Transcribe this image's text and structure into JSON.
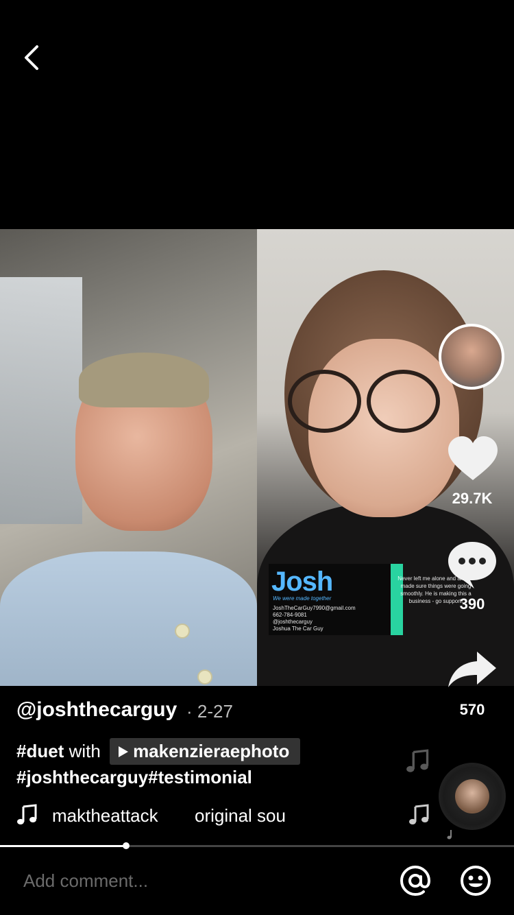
{
  "video": {
    "business_card": {
      "name": "Josh",
      "tagline": "We were made together",
      "email": "JoshTheCarGuy7990@gmail.com",
      "phone": "662-784-9081",
      "tiktok": "@joshthecarguy",
      "youtube": "Joshua The Car Guy"
    },
    "overlay_text": "Never left me alone and always made sure things were going smoothly. He is making this a business - go support!"
  },
  "actions": {
    "likes": "29.7K",
    "comments": "390",
    "shares": "570"
  },
  "post": {
    "username": "@joshthecarguy",
    "date": "· 2-27",
    "duet_prefix": "#duet",
    "duet_with": "with",
    "duet_user": "makenzieraephoto",
    "hashtags": "#joshthecarguy#testimonial",
    "music_author": "maktheattack",
    "music_title": "original sound"
  },
  "progress": {
    "fraction": 0.245
  },
  "comment": {
    "placeholder": "Add comment..."
  },
  "icons": {
    "back": "chevron-left-icon",
    "like": "heart-icon",
    "comment": "speech-bubble-icon",
    "share": "share-arrow-icon",
    "mention": "at-icon",
    "emoji": "emoji-icon",
    "music": "music-note-icon"
  }
}
